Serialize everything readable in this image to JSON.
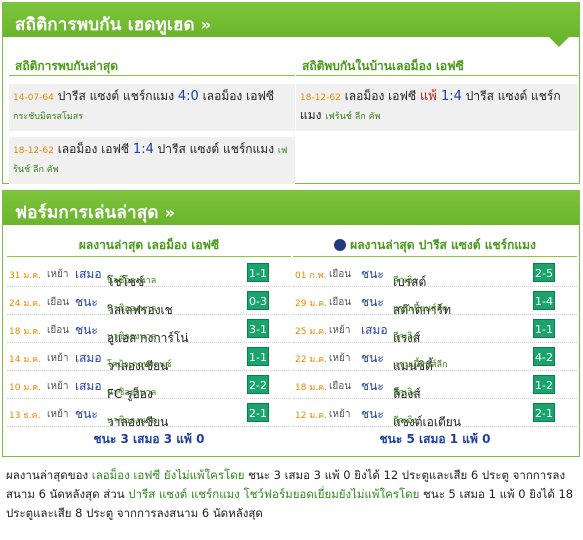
{
  "h2h": {
    "title": "สถิติการพบกัน เฮดทูเฮด",
    "chevron": "»",
    "left": {
      "title": "สถิติการพบกันล่าสุด",
      "matches": [
        {
          "date": "14-07-64",
          "home": "ปารีส แซงต์ แชร์กแมง",
          "score": "4:0",
          "away": "เลอม็อง เอฟซี",
          "league": "กระชับมิตรสโมสร"
        },
        {
          "date": "18-12-62",
          "home": "เลอม็อง เอฟซี",
          "score": "1:4",
          "away": "ปารีส แซงต์ แชร์กแมง",
          "league": "เฟร้นช์ ลีก คัพ"
        }
      ]
    },
    "right": {
      "title": "สถิติพบกันในบ้านเลอม็อง เอฟซี",
      "matches": [
        {
          "date": "18-12-62",
          "home": "เลอม็อง เอฟซี",
          "result_tag": "แพ้",
          "score": "1:4",
          "away": "ปารีส แซงต์ แชร์กแมง",
          "league": "เฟร้นช์ ลีก คัพ"
        }
      ]
    }
  },
  "form": {
    "title": "ฟอร์มการเล่นล่าสุด",
    "chevron": "»",
    "left": {
      "title": "ผลงานล่าสุด เลอม็อง เอฟซี",
      "rows": [
        {
          "date": "31 ม.ค.",
          "venue": "เหย้า",
          "result": "เสมอ",
          "opp": "โชโซซ์",
          "league": "นาซิอองนาล",
          "score": "1-1"
        },
        {
          "date": "24 ม.ค.",
          "venue": "เยือน",
          "result": "ชนะ",
          "opp": "วิลเลฟรองเช",
          "league": "นาซิอองนาล",
          "score": "0-3"
        },
        {
          "date": "18 ม.ค.",
          "venue": "เยือน",
          "result": "ชนะ",
          "opp": "อูแอส กงการ์โน่",
          "league": "นาซิอองนาล",
          "score": "3-1"
        },
        {
          "date": "14 ม.ค.",
          "venue": "เหย้า",
          "result": "เสมอ",
          "opp": "วาลองเซียน",
          "league": "โคป้าเดอฟรานซ์",
          "score": "1-1"
        },
        {
          "date": "10 ม.ค.",
          "venue": "เหย้า",
          "result": "เสมอ",
          "opp": "FC รูอ็อง",
          "league": "นาซิอองนาล",
          "score": "2-2"
        },
        {
          "date": "13 ธ.ค.",
          "venue": "เหย้า",
          "result": "ชนะ",
          "opp": "วาลองเซียน",
          "league": "นาซิอองนาล",
          "score": "2-1"
        }
      ],
      "summary": "ชนะ 3 เสมอ 3 แพ้ 0"
    },
    "right": {
      "title": "ผลงานล่าสุด ปารีส แซงต์ แชร์กแมง",
      "rows": [
        {
          "date": "01 ก.พ.",
          "venue": "เยือน",
          "result": "ชนะ",
          "opp": "เบรสต์",
          "league": "ลีกเอิง",
          "score": "2-5"
        },
        {
          "date": "29 ม.ค.",
          "venue": "เยือน",
          "result": "ชนะ",
          "opp": "สต๊าดการ์ท",
          "league": "แชมเปี้ยนส์ลีก",
          "score": "1-4"
        },
        {
          "date": "25 ม.ค.",
          "venue": "เหย้า",
          "result": "เสมอ",
          "opp": "แรงส์",
          "league": "ลีกเอิง",
          "score": "1-1"
        },
        {
          "date": "22 ม.ค.",
          "venue": "เหย้า",
          "result": "ชนะ",
          "opp": "แมนซิตี้",
          "league": "แชมเปี้ยนส์ลีก",
          "score": "4-2"
        },
        {
          "date": "18 ม.ค.",
          "venue": "เยือน",
          "result": "ชนะ",
          "opp": "ล็องส์",
          "league": "ลีกเอิง",
          "score": "1-2"
        },
        {
          "date": "12 ม.ค.",
          "venue": "เหย้า",
          "result": "ชนะ",
          "opp": "แซงต์เอเตียน",
          "league": "ลีกเอิง",
          "score": "2-1"
        }
      ],
      "summary": "ชนะ 5 เสมอ 1 แพ้ 0"
    }
  },
  "footer": {
    "p1": "ผลงานล่าสุดของ",
    "team1": "เลอม็อง เอฟซี ยังไม่แพ้ใครโดย",
    "p2": "ชนะ 3 เสมอ 3 แพ้ 0 ยิงได้ 12 ประตูและเสีย 6 ประตู จากการลงสนาม 6 นัดหลังสุด ส่วน",
    "team2": "ปารีส แซงต์ แชร์กแมง โชว์ฟอร์มยอดเยี่ยมยังไม่แพ้ใครโดย",
    "p3": "ชนะ 5 เสมอ 1 แพ้ 0 ยิงได้ 18 ประตูและเสีย 8 ประตู จากการลงสนาม 6 นัดหลังสุด"
  }
}
